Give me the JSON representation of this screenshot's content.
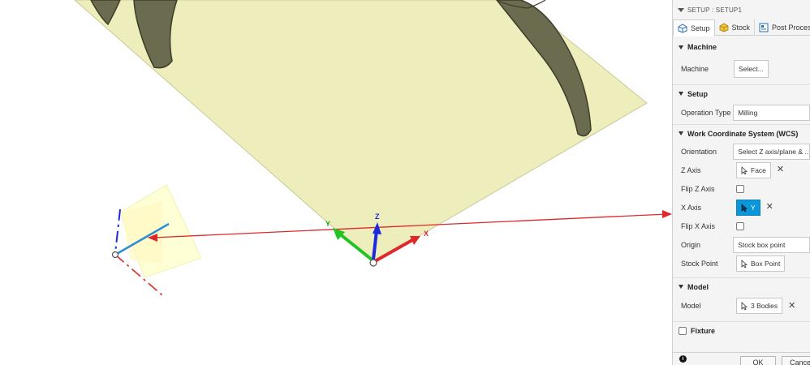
{
  "viewport": {
    "axis_labels": {
      "x": "X",
      "y": "Y",
      "z": "Z"
    },
    "colors": {
      "plate_fill": "#eeeebd",
      "plate_stroke": "#c9c99a",
      "slot_fill": "#6b6b4f",
      "arrow_red": "#e0282a"
    }
  },
  "panel": {
    "title": "SETUP : SETUP1",
    "tabs": [
      {
        "label": "Setup",
        "icon": "setup-icon"
      },
      {
        "label": "Stock",
        "icon": "stock-cube-icon"
      },
      {
        "label": "Post Process",
        "icon": "post-process-icon"
      }
    ],
    "sections": {
      "machine": {
        "title": "Machine",
        "machine_label": "Machine",
        "machine_button": "Select..."
      },
      "setup": {
        "title": "Setup",
        "operation_type_label": "Operation Type",
        "operation_type_value": "Milling"
      },
      "wcs": {
        "title": "Work Coordinate System (WCS)",
        "orientation_label": "Orientation",
        "orientation_value": "Select Z axis/plane & ...",
        "z_axis_label": "Z Axis",
        "z_axis_value": "Face",
        "flip_z_label": "Flip Z Axis",
        "x_axis_label": "X Axis",
        "x_axis_value": "Y",
        "flip_x_label": "Flip X Axis",
        "origin_label": "Origin",
        "origin_value": "Stock box point",
        "stock_point_label": "Stock Point",
        "stock_point_value": "Box Point"
      },
      "model": {
        "title": "Model",
        "model_label": "Model",
        "model_value": "3 Bodies"
      },
      "fixture": {
        "title": "Fixture"
      }
    },
    "footer": {
      "ok": "OK",
      "cancel": "Cancel"
    },
    "colors": {
      "selected": "#0a96d8"
    }
  }
}
